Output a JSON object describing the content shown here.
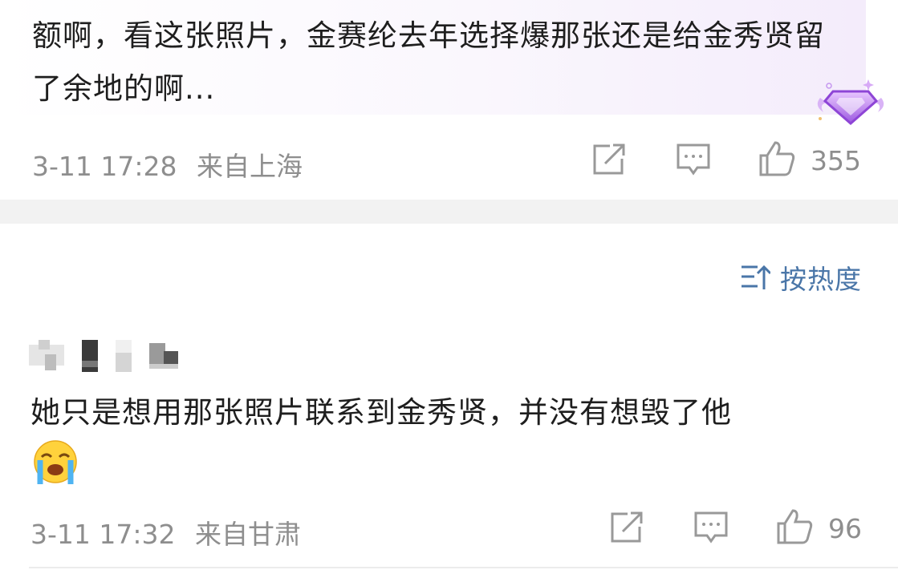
{
  "comment1": {
    "text": "额啊，看这张照片，金赛纶去年选择爆那张还是给金秀贤留了余地的啊...",
    "time": "3-11 17:28",
    "location": "来自上海",
    "likes": "355"
  },
  "sort": {
    "label": "按热度",
    "icon": "sort-icon"
  },
  "comment2": {
    "text": "她只是想用那张照片联系到金秀贤，并没有想毁了他",
    "emoji": "crying-face-emoji",
    "time": "3-11 17:32",
    "location": "来自甘肃",
    "likes": "96"
  },
  "colors": {
    "accent_link": "#4a76a8",
    "meta_gray": "#8e8e8e",
    "badge_purple": "#b57be8"
  }
}
